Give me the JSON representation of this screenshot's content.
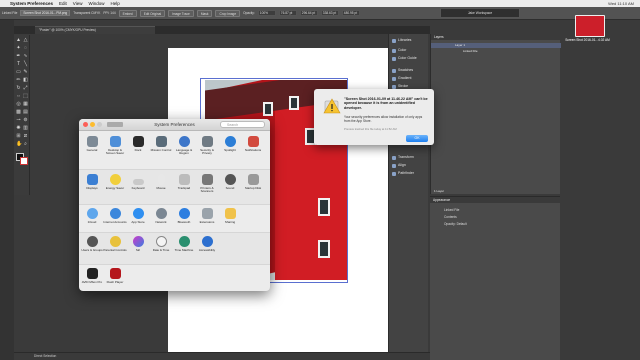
{
  "menubar": {
    "app": "System Preferences",
    "items": [
      "Edit",
      "View",
      "Window",
      "Help"
    ],
    "status": "Wed 11:10 AM"
  },
  "control_bar": {
    "linked_file": "Linked File",
    "filename": "Screen Shot 2016-01...PM.png",
    "mode": "Transparent CMYK",
    "ppi": "PPI: 144",
    "buttons": [
      "Embed",
      "Edit Original",
      "Image Trace",
      "Mask",
      "Crop Image"
    ],
    "opacity_label": "Opacity:",
    "opacity": "100%",
    "x": "76.87 pt",
    "y": "296.64 pt",
    "w": "338.63 pt",
    "h": "480.95 pt"
  },
  "workspace": "Jake Workspace",
  "document_tab": "\"Poster\" @ 100% (CMYK/GPU Preview)",
  "status_bar": "Direct Selection",
  "panels": {
    "dock": [
      "Libraries",
      "Color",
      "Color Guide",
      "Swatches",
      "Gradient",
      "Stroke",
      "Brushes",
      "Symbols",
      "Graphic Styles",
      "Transform",
      "Align",
      "Pathfinder"
    ]
  },
  "layers": {
    "header": "Layers",
    "rows": [
      "Layer 1",
      "Linked File"
    ],
    "footer": "1 Layer"
  },
  "appearance": {
    "header": "Appearance",
    "rows": [
      "Linked File",
      "Contents",
      "Opacity: Default"
    ]
  },
  "desktop_file": {
    "label": "Screen Shot 2016-01...4.02 AM"
  },
  "sysprefs": {
    "title": "System Preferences",
    "search_placeholder": "Search",
    "row1": [
      "General",
      "Desktop & Screen Saver",
      "Dock",
      "Mission Control",
      "Language & Region",
      "Security & Privacy",
      "Spotlight",
      "Notifications"
    ],
    "row2": [
      "Displays",
      "Energy Saver",
      "Keyboard",
      "Mouse",
      "Trackpad",
      "Printers & Scanners",
      "Sound",
      "Startup Disk"
    ],
    "row3": [
      "iCloud",
      "Internet Accounts",
      "App Store",
      "Network",
      "Bluetooth",
      "Extensions",
      "Sharing"
    ],
    "row4": [
      "Users & Groups",
      "Parental Controls",
      "Siri",
      "Date & Time",
      "Time Machine",
      "Accessibility"
    ],
    "row5": [
      "AVID Mbox Pro",
      "Flash Player"
    ]
  },
  "alert": {
    "title": "\"Screen Shot 2016-01-09 at 11.46.22 AM\" can't be opened because it is from an unidentified developer.",
    "body": "Your security preferences allow installation of only apps from the App Store.",
    "note": "Preview trashed this file today at 11:52 AM",
    "ok": "OK"
  }
}
